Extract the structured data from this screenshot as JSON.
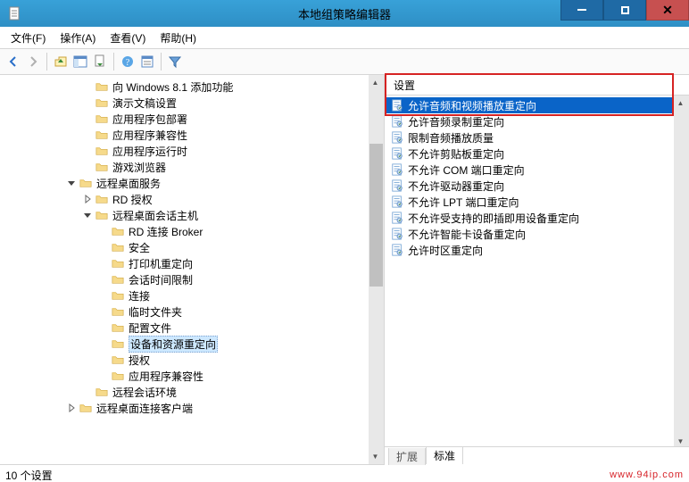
{
  "window": {
    "title": "本地组策略编辑器"
  },
  "menu": {
    "file": "文件(F)",
    "action": "操作(A)",
    "view": "查看(V)",
    "help": "帮助(H)"
  },
  "tree": {
    "nodes": [
      {
        "indent": 5,
        "toggle": "",
        "icon": "folder",
        "label": "向 Windows 8.1 添加功能"
      },
      {
        "indent": 5,
        "toggle": "",
        "icon": "folder",
        "label": "演示文稿设置"
      },
      {
        "indent": 5,
        "toggle": "",
        "icon": "folder",
        "label": "应用程序包部署"
      },
      {
        "indent": 5,
        "toggle": "",
        "icon": "folder",
        "label": "应用程序兼容性"
      },
      {
        "indent": 5,
        "toggle": "",
        "icon": "folder",
        "label": "应用程序运行时"
      },
      {
        "indent": 5,
        "toggle": "",
        "icon": "folder",
        "label": "游戏浏览器"
      },
      {
        "indent": 4,
        "toggle": "down",
        "icon": "folder",
        "label": "远程桌面服务"
      },
      {
        "indent": 5,
        "toggle": "right",
        "icon": "folder",
        "label": "RD 授权"
      },
      {
        "indent": 5,
        "toggle": "down",
        "icon": "folder",
        "label": "远程桌面会话主机"
      },
      {
        "indent": 6,
        "toggle": "",
        "icon": "folder",
        "label": "RD 连接 Broker"
      },
      {
        "indent": 6,
        "toggle": "",
        "icon": "folder",
        "label": "安全"
      },
      {
        "indent": 6,
        "toggle": "",
        "icon": "folder",
        "label": "打印机重定向"
      },
      {
        "indent": 6,
        "toggle": "",
        "icon": "folder",
        "label": "会话时间限制"
      },
      {
        "indent": 6,
        "toggle": "",
        "icon": "folder",
        "label": "连接"
      },
      {
        "indent": 6,
        "toggle": "",
        "icon": "folder",
        "label": "临时文件夹"
      },
      {
        "indent": 6,
        "toggle": "",
        "icon": "folder",
        "label": "配置文件"
      },
      {
        "indent": 6,
        "toggle": "",
        "icon": "folder",
        "label": "设备和资源重定向",
        "selected": true
      },
      {
        "indent": 6,
        "toggle": "",
        "icon": "folder",
        "label": "授权"
      },
      {
        "indent": 6,
        "toggle": "",
        "icon": "folder",
        "label": "应用程序兼容性"
      },
      {
        "indent": 5,
        "toggle": "",
        "icon": "folder",
        "label": "远程会话环境"
      },
      {
        "indent": 4,
        "toggle": "right",
        "icon": "folder",
        "label": "远程桌面连接客户端"
      }
    ]
  },
  "list": {
    "header": "设置",
    "items": [
      {
        "label": "允许音频和视频播放重定向",
        "selected": true
      },
      {
        "label": "允许音频录制重定向"
      },
      {
        "label": "限制音频播放质量"
      },
      {
        "label": "不允许剪贴板重定向"
      },
      {
        "label": "不允许 COM 端口重定向"
      },
      {
        "label": "不允许驱动器重定向"
      },
      {
        "label": "不允许 LPT 端口重定向"
      },
      {
        "label": "不允许受支持的即插即用设备重定向"
      },
      {
        "label": "不允许智能卡设备重定向"
      },
      {
        "label": "允许时区重定向"
      }
    ],
    "tabs": {
      "extended": "扩展",
      "standard": "标准"
    }
  },
  "status": {
    "text": "10 个设置",
    "watermark": "www.94ip.com"
  }
}
